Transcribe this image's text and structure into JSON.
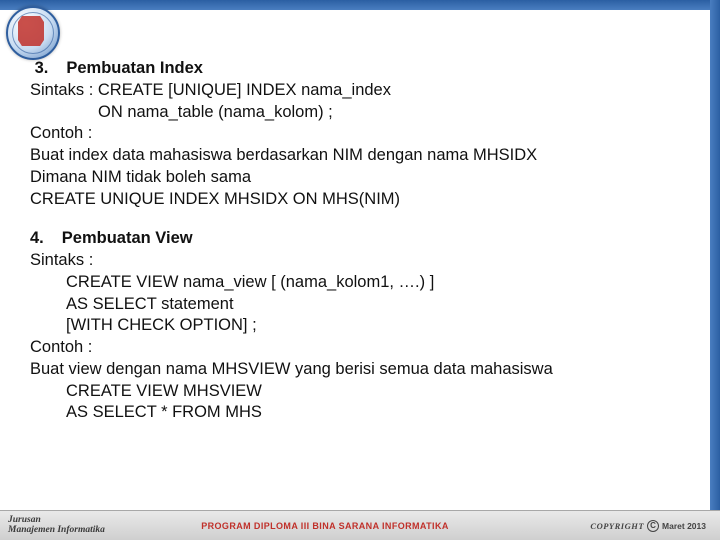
{
  "logo_alt": "BSI Informatika logo",
  "section3": {
    "num": "3.",
    "title": "Pembuatan Index",
    "lines": [
      "Sintaks : CREATE [UNIQUE] INDEX  nama_index",
      "ON nama_table (nama_kolom) ;",
      "Contoh :",
      "Buat index data mahasiswa berdasarkan NIM dengan nama MHSIDX",
      "Dimana NIM tidak boleh sama",
      "CREATE UNIQUE  INDEX MHSIDX ON MHS(NIM)"
    ]
  },
  "section4": {
    "num": "4.",
    "title": "Pembuatan View",
    "lines": [
      "Sintaks :",
      "CREATE VIEW nama_view [ (nama_kolom1, ….) ]",
      "AS SELECT statement",
      "[WITH CHECK OPTION] ;",
      "Contoh :",
      "Buat view dengan nama MHSVIEW yang berisi semua data mahasiswa",
      "CREATE VIEW MHSVIEW",
      "AS SELECT * FROM MHS"
    ]
  },
  "footer": {
    "left_line1": "Jurusan",
    "left_line2": "Manajemen Informatika",
    "center": "PROGRAM DIPLOMA III BINA SARANA INFORMATIKA",
    "copyright_word": "COPYRIGHT",
    "copyright_symbol": "C",
    "date": "Maret 2013"
  }
}
